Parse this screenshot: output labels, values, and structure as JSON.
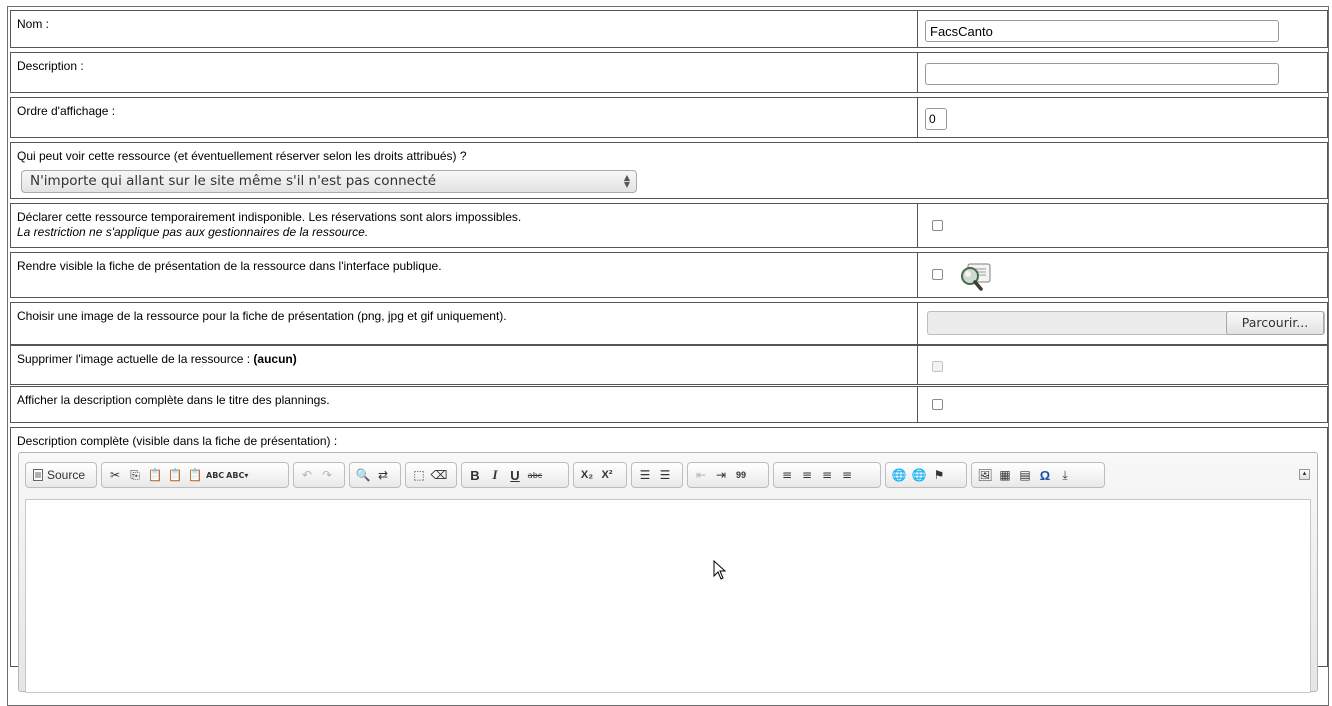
{
  "form": {
    "name": {
      "label": "Nom :",
      "value": "FacsCanto"
    },
    "description": {
      "label": "Description :",
      "value": ""
    },
    "order": {
      "label": "Ordre d'affichage :",
      "value": "0"
    },
    "visibility": {
      "label": "Qui peut voir cette ressource (et éventuellement réserver selon les droits attribués) ?",
      "selected": "N'importe qui allant sur le site même s'il n'est pas connecté"
    },
    "unavailable": {
      "label": "Déclarer cette ressource temporairement indisponible. Les réservations sont alors impossibles.",
      "note": "La restriction ne s'applique pas aux gestionnaires de la ressource."
    },
    "public_sheet": {
      "label": "Rendre visible la fiche de présentation de la ressource dans l'interface publique."
    },
    "image": {
      "label": "Choisir une image de la ressource pour la fiche de présentation (png, jpg et gif uniquement).",
      "browse_label": "Parcourir..."
    },
    "delete_image": {
      "label_prefix": "Supprimer l'image actuelle de la ressource :",
      "label_value": "(aucun)"
    },
    "planning_title": {
      "label": "Afficher la description complète dans le titre des plannings."
    },
    "full_description": {
      "label": "Description complète (visible dans la fiche de présentation) :"
    }
  },
  "editor": {
    "source_label": "Source",
    "buttons": {
      "bold": "B",
      "italic": "I",
      "underline": "U",
      "strike": "abc",
      "subscript": "X₂",
      "superscript": "X²",
      "blockquote": "99",
      "special_char": "Ω",
      "spell_1": "ABC",
      "spell_2": "ABC"
    }
  },
  "colors": {
    "border": "#555555",
    "toolbar_bg": "#e9e9e9",
    "input_border": "#9a9a9a"
  }
}
